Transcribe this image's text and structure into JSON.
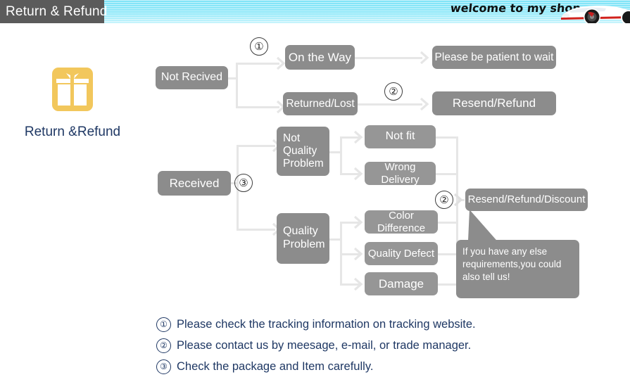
{
  "header": {
    "title": "Return & Refund",
    "welcome": "welcome to my shop",
    "car_icon": "sports-car-image",
    "bar_color": "#8ee8f9",
    "title_bg": "#5b5b5b"
  },
  "brand": {
    "icon": "gift-box-icon",
    "icon_color": "#f2c75c",
    "label": "Return &Refund",
    "label_color": "#1f3864"
  },
  "flow": {
    "node_color": "#8c8c8c",
    "line_color": "#e6e6e6",
    "nodes": {
      "not_received": "Not Recived",
      "on_the_way": "On the Way",
      "returned_lost": "Returned/Lost",
      "please_wait": "Please be patient to wait",
      "resend_refund": "Resend/Refund",
      "received": "Received",
      "not_quality_problem": "Not\nQuality\nProblem",
      "quality_problem": "Quality\nProblem",
      "not_fit": "Not fit",
      "wrong_delivery": "Wrong Delivery",
      "color_difference": "Color Difference",
      "quality_defect": "Quality Defect",
      "damage": "Damage",
      "resend_refund_discount": "Resend/Refund/Discount"
    },
    "markers": {
      "m1": "①",
      "m2_top": "②",
      "m3": "③",
      "m2_bottom": "②"
    }
  },
  "callout": {
    "text": "If you have any else requirements,you could also tell us!"
  },
  "footer": {
    "notes": [
      {
        "num": "①",
        "text": "Please check the tracking information on tracking website."
      },
      {
        "num": "②",
        "text": "Please contact us by meesage, e-mail, or trade manager."
      },
      {
        "num": "③",
        "text": "Check the package and Item carefully."
      }
    ]
  }
}
